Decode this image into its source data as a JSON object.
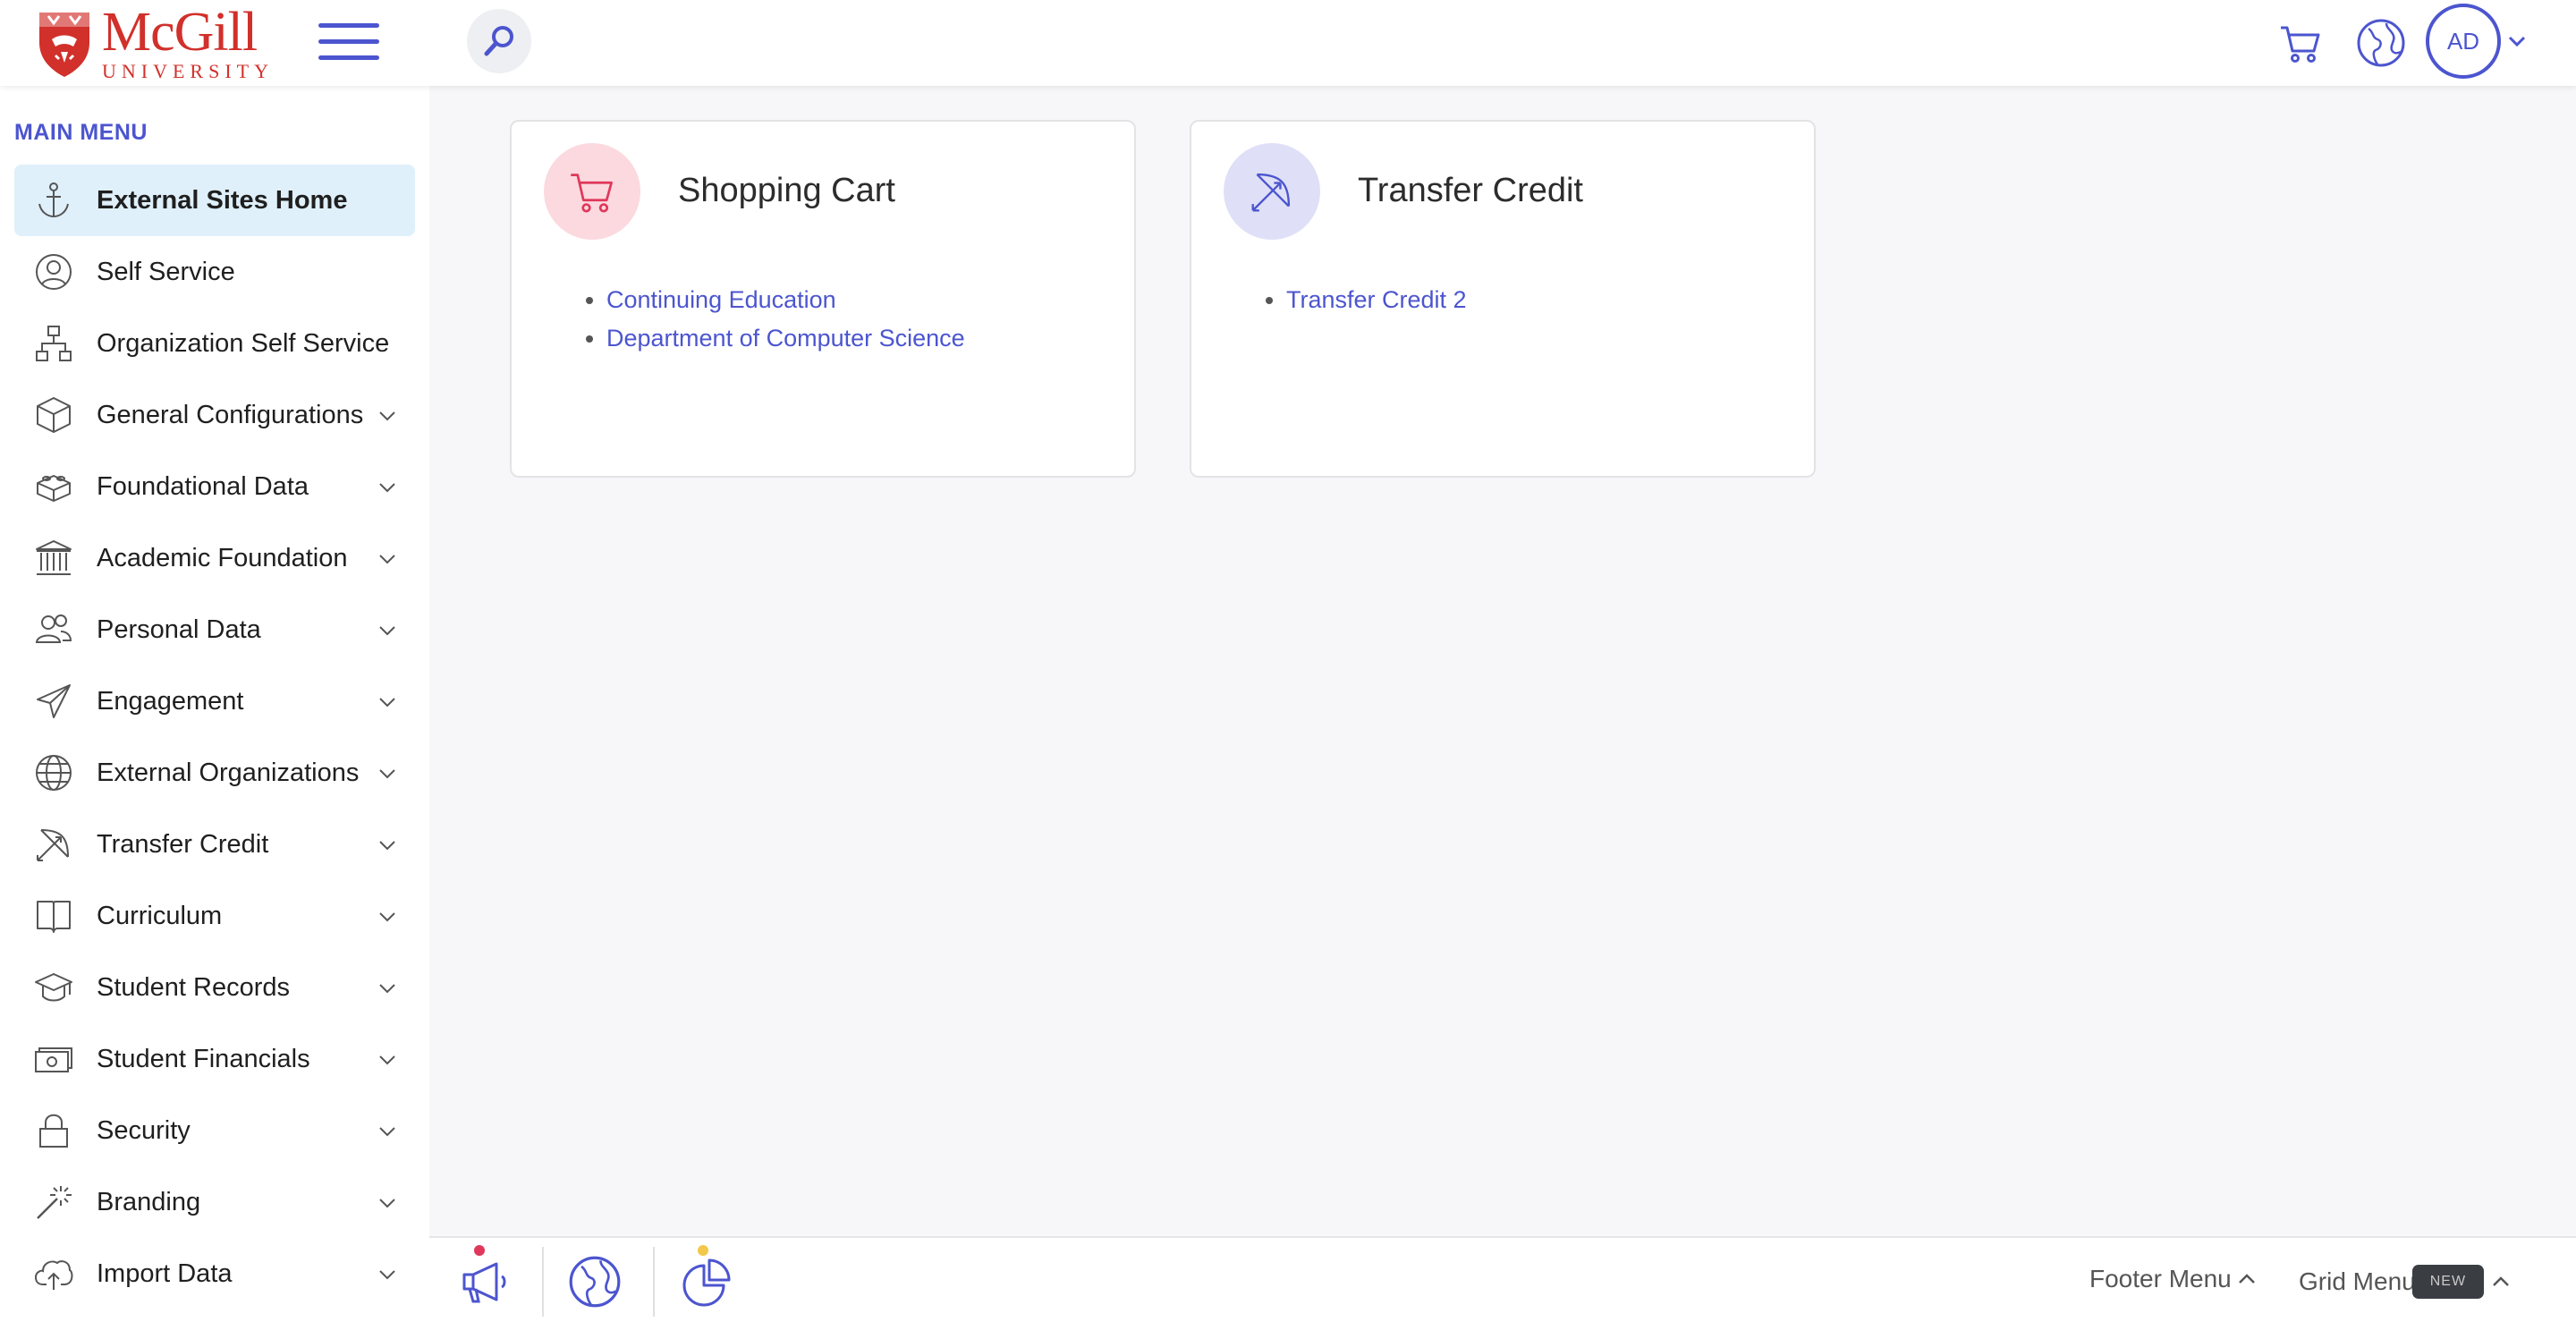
{
  "header": {
    "logo_main": "McGill",
    "logo_sub": "UNIVERSITY",
    "avatar_initials": "AD",
    "accent_color": "#4c55cf",
    "brand_color": "#d1302b"
  },
  "sidebar": {
    "title": "MAIN MENU",
    "items": [
      {
        "label": "External Sites Home",
        "icon": "anchor-icon",
        "active": true,
        "expandable": false
      },
      {
        "label": "Self Service",
        "icon": "user-icon",
        "expandable": false
      },
      {
        "label": "Organization Self Service",
        "icon": "org-chart-icon",
        "expandable": false
      },
      {
        "label": "General Configurations",
        "icon": "cube-icon",
        "expandable": true
      },
      {
        "label": "Foundational Data",
        "icon": "bricks-icon",
        "expandable": true
      },
      {
        "label": "Academic Foundation",
        "icon": "institution-icon",
        "expandable": true
      },
      {
        "label": "Personal Data",
        "icon": "users-icon",
        "expandable": true
      },
      {
        "label": "Engagement",
        "icon": "paper-plane-icon",
        "expandable": true
      },
      {
        "label": "External Organizations",
        "icon": "globe-icon",
        "expandable": true
      },
      {
        "label": "Transfer Credit",
        "icon": "bow-arrow-icon",
        "expandable": true
      },
      {
        "label": "Curriculum",
        "icon": "book-icon",
        "expandable": true
      },
      {
        "label": "Student Records",
        "icon": "graduation-cap-icon",
        "expandable": true
      },
      {
        "label": "Student Financials",
        "icon": "money-icon",
        "expandable": true
      },
      {
        "label": "Security",
        "icon": "lock-icon",
        "expandable": true
      },
      {
        "label": "Branding",
        "icon": "magic-wand-icon",
        "expandable": true
      },
      {
        "label": "Import Data",
        "icon": "cloud-upload-icon",
        "expandable": true
      }
    ]
  },
  "cards": [
    {
      "title": "Shopping Cart",
      "icon": "cart-icon",
      "icon_bg": "#fbd9df",
      "icon_color": "#e0375a",
      "links": [
        "Continuing Education",
        "Department of Computer Science"
      ]
    },
    {
      "title": "Transfer Credit",
      "icon": "bow-arrow-icon",
      "icon_bg": "#dfe0f7",
      "icon_color": "#4c55cf",
      "links": [
        "Transfer Credit 2"
      ]
    }
  ],
  "footer": {
    "footer_menu_label": "Footer Menu",
    "grid_menu_label": "Grid Menu",
    "new_badge": "NEW"
  }
}
